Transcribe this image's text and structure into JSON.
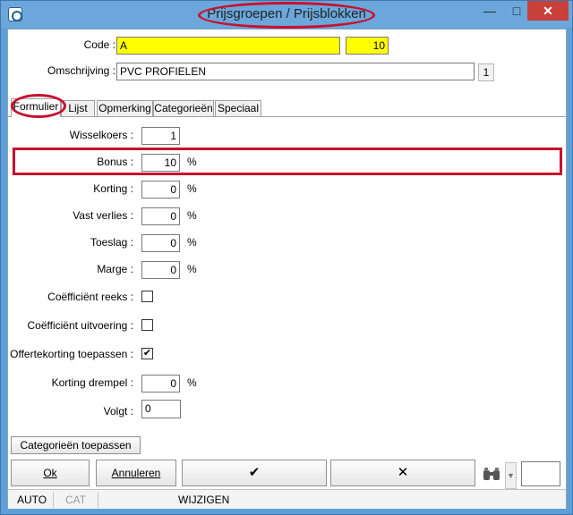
{
  "window": {
    "title": "Prijsgroepen / Prijsblokken",
    "min_glyph": "—",
    "max_glyph": "□",
    "close_glyph": "✕"
  },
  "header": {
    "code_label": "Code :",
    "code_value": "A",
    "code_number": "10",
    "omschrijving_label": "Omschrijving :",
    "omschrijving_value": "PVC PROFIELEN",
    "badge": "1"
  },
  "tabs": [
    {
      "label": "Formulier"
    },
    {
      "label": "Lijst"
    },
    {
      "label": "Opmerking"
    },
    {
      "label": "Categorieën"
    },
    {
      "label": "Speciaal"
    }
  ],
  "form": {
    "wisselkoers": {
      "label": "Wisselkoers :",
      "value": "1"
    },
    "bonus": {
      "label": "Bonus :",
      "value": "10",
      "unit": "%"
    },
    "korting": {
      "label": "Korting :",
      "value": "0",
      "unit": "%"
    },
    "vast_verlies": {
      "label": "Vast verlies :",
      "value": "0",
      "unit": "%"
    },
    "toeslag": {
      "label": "Toeslag :",
      "value": "0",
      "unit": "%"
    },
    "marge": {
      "label": "Marge :",
      "value": "0",
      "unit": "%"
    },
    "coef_reeks": {
      "label": "Coëfficiënt reeks :",
      "checked": false
    },
    "coef_uitvoering": {
      "label": "Coëfficiënt uitvoering :",
      "checked": false
    },
    "offertekorting": {
      "label": "Offertekorting toepassen :",
      "checked": true,
      "check_glyph": "✔"
    },
    "korting_drempel": {
      "label": "Korting drempel :",
      "value": "0",
      "unit": "%"
    },
    "volgt": {
      "label": "Volgt :",
      "value": "0"
    }
  },
  "buttons": {
    "categorieen_toepassen": "Categorieën toepassen",
    "ok": "Ok",
    "annuleren": "Annuleren",
    "confirm_glyph": "✔",
    "cancel_glyph": "✕",
    "dropdown_glyph": "▼"
  },
  "status": {
    "auto": "AUTO",
    "cat": "CAT",
    "mode": "WIJZIGEN"
  },
  "colors": {
    "highlight": "#c8102e",
    "field_yellow": "#ffff00",
    "title_bar": "#6ba7da"
  }
}
